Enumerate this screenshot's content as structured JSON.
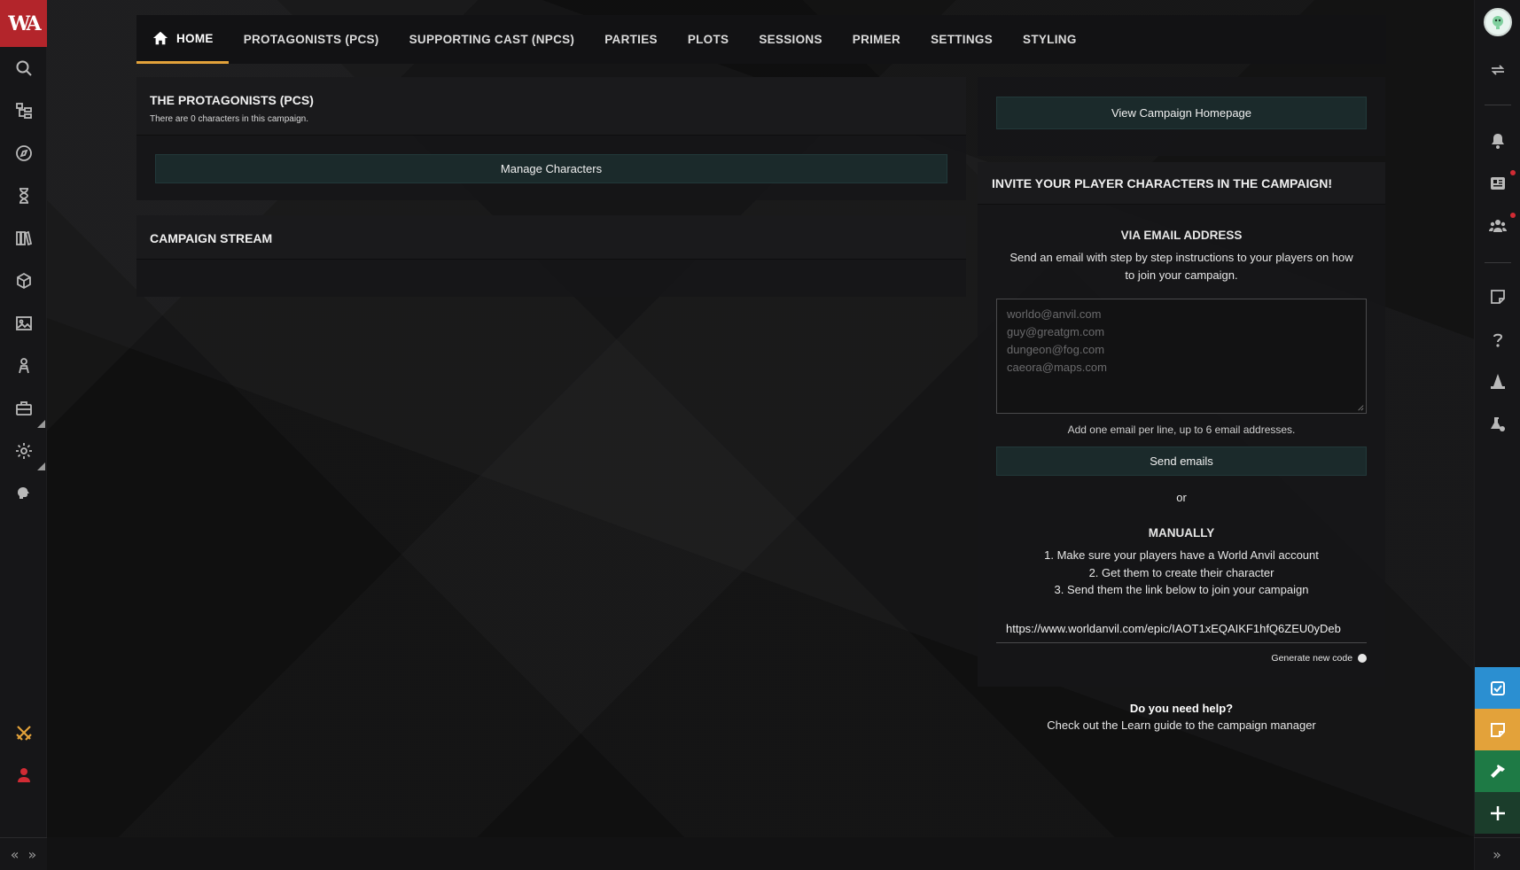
{
  "app": {
    "logo_text": "WA",
    "brand_color": "#b3252b",
    "accent_color": "#e3a23a"
  },
  "left_sidebar": {
    "icons": [
      "search-icon",
      "tree-icon",
      "compass-icon",
      "hourglass-icon",
      "books-icon",
      "cube-icon",
      "image-icon",
      "character-icon",
      "toolbox-icon",
      "gear-icon",
      "brain-icon",
      "sword-icon",
      "user-icon"
    ]
  },
  "nav": {
    "tabs": [
      {
        "label": "HOME",
        "active": true
      },
      {
        "label": "PROTAGONISTS (PCS)"
      },
      {
        "label": "SUPPORTING CAST (NPCS)"
      },
      {
        "label": "PARTIES"
      },
      {
        "label": "PLOTS"
      },
      {
        "label": "SESSIONS"
      },
      {
        "label": "PRIMER"
      },
      {
        "label": "SETTINGS"
      },
      {
        "label": "STYLING"
      }
    ]
  },
  "protagonists": {
    "title": "THE PROTAGONISTS (PCS)",
    "subtitle": "There are 0 characters in this campaign.",
    "manage_button": "Manage Characters"
  },
  "stream": {
    "title": "CAMPAIGN STREAM"
  },
  "campaign": {
    "homepage_button": "View Campaign Homepage"
  },
  "invite": {
    "title": "INVITE YOUR PLAYER CHARACTERS IN THE CAMPAIGN!",
    "email_heading": "VIA EMAIL ADDRESS",
    "email_desc_line1": "Send an email with step by step instructions to your players on how",
    "email_desc_line2": "to join your campaign.",
    "email_placeholder_lines": [
      "worldo@anvil.com",
      "guy@greatgm.com",
      "dungeon@fog.com",
      "caeora@maps.com"
    ],
    "email_hint": "Add one email per line, up to 6 email addresses.",
    "send_button": "Send emails",
    "or": "or",
    "manual_heading": "MANUALLY",
    "step1": "1. Make sure your players have a World Anvil account",
    "step2": "2. Get them to create their character",
    "step3": "3. Send them the link below to join your campaign",
    "link_value": "https://www.worldanvil.com/epic/IAOT1xEQAIKF1hfQ6ZEU0yDeb",
    "generate_code": "Generate new code"
  },
  "help": {
    "title": "Do you need help?",
    "text": "Check out the Learn guide to the campaign manager"
  },
  "right_sidebar": {
    "icons": [
      "avatar",
      "sync-icon",
      "bell-icon",
      "news-icon",
      "group-icon",
      "note-icon",
      "help-icon",
      "wizard-hat-icon",
      "lab-settings-icon"
    ],
    "actions": [
      {
        "icon": "checkbox-icon",
        "color": "#2b8fd1"
      },
      {
        "icon": "sticky-note-icon",
        "color": "#e3a23a"
      },
      {
        "icon": "hammer-icon",
        "color": "#1e7a45"
      },
      {
        "icon": "plus-icon",
        "color": "#1b3d2b"
      }
    ]
  }
}
